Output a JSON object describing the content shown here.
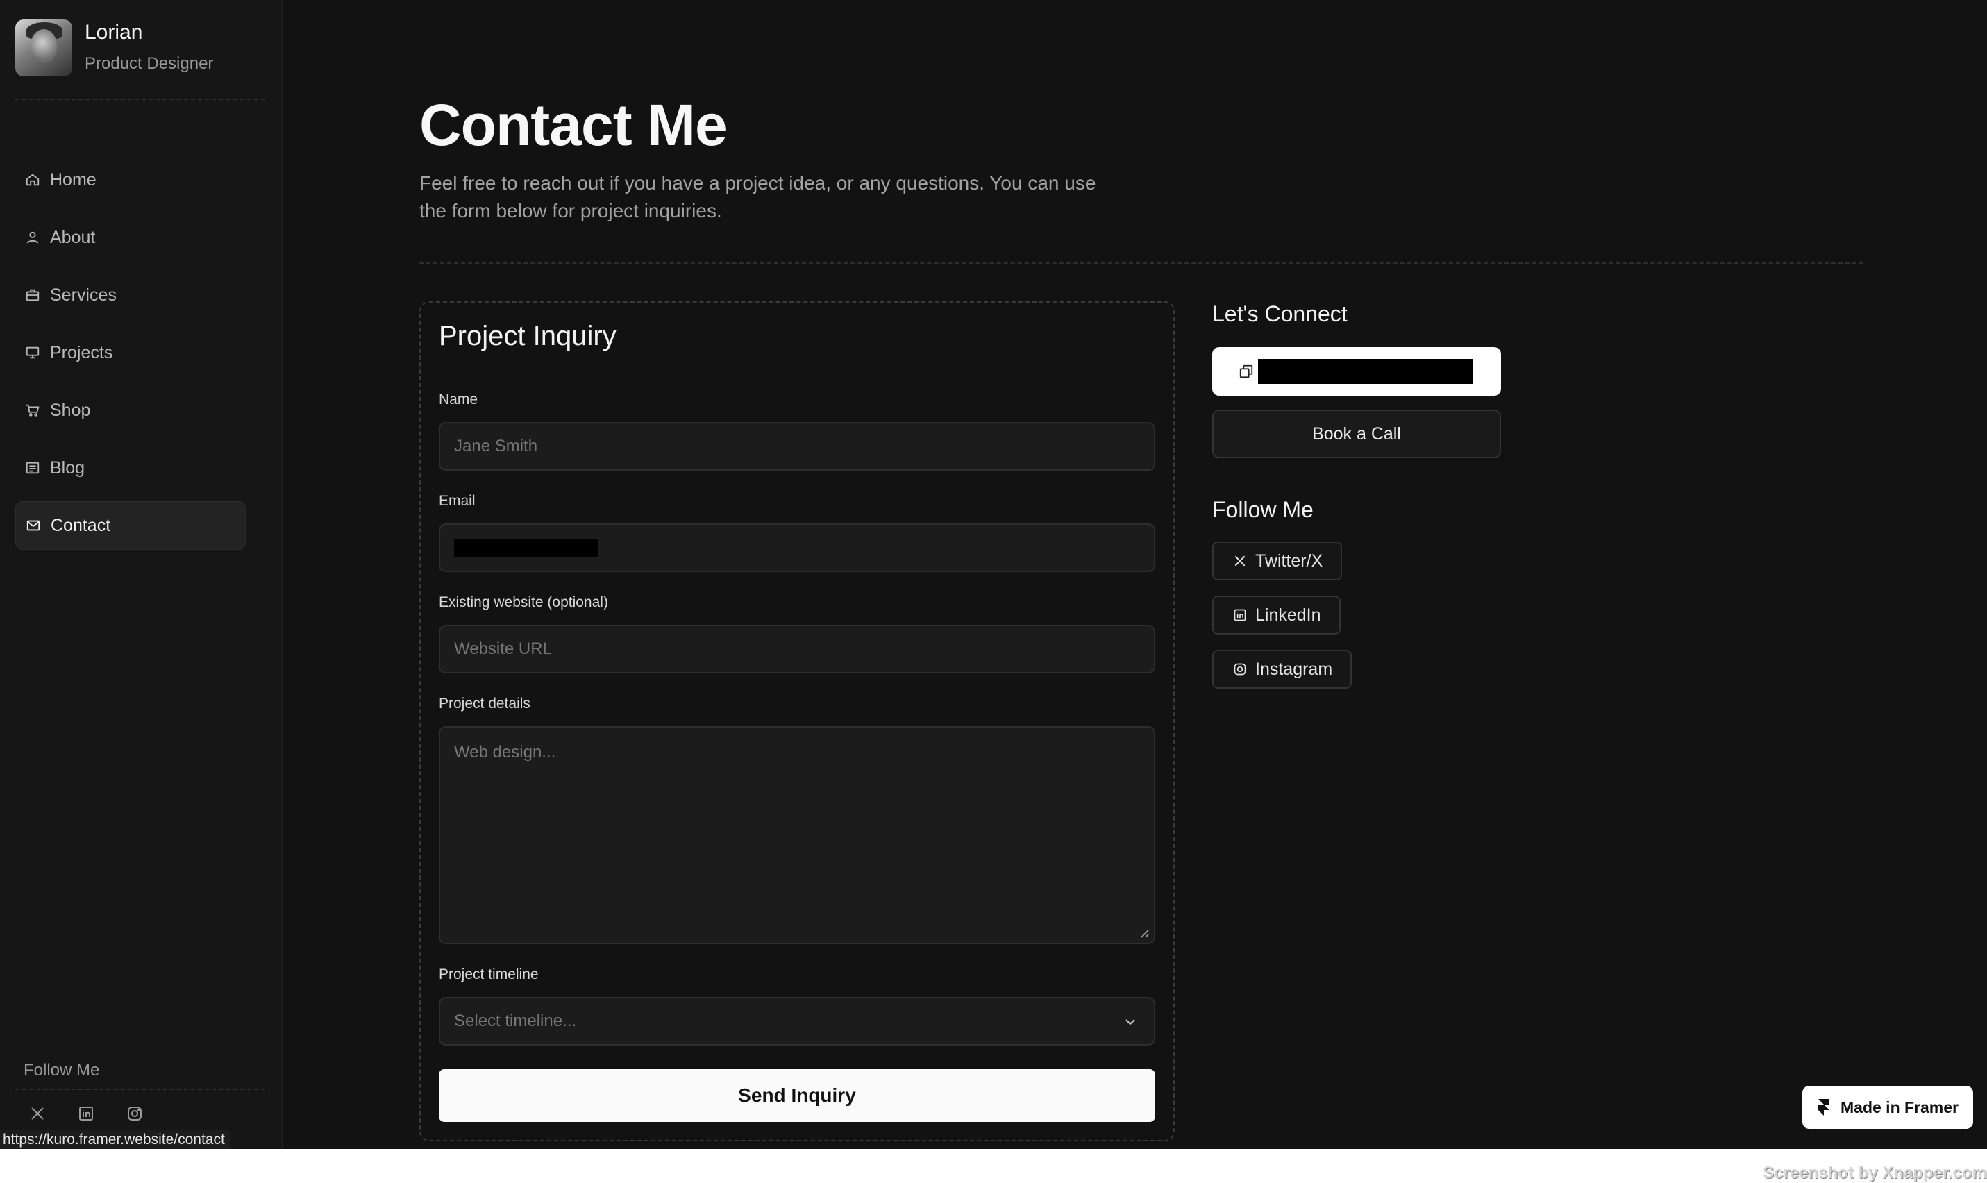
{
  "profile": {
    "name": "Lorian",
    "role": "Product Designer"
  },
  "nav": {
    "items": [
      {
        "label": "Home",
        "icon": "home-icon"
      },
      {
        "label": "About",
        "icon": "user-icon"
      },
      {
        "label": "Services",
        "icon": "briefcase-icon"
      },
      {
        "label": "Projects",
        "icon": "projects-icon"
      },
      {
        "label": "Shop",
        "icon": "cart-icon"
      },
      {
        "label": "Blog",
        "icon": "blog-icon"
      },
      {
        "label": "Contact",
        "icon": "mail-icon",
        "active": true
      }
    ]
  },
  "sidebar_follow": {
    "label": "Follow Me",
    "icons": [
      "x-icon",
      "linkedin-icon",
      "instagram-icon"
    ]
  },
  "status_bar": {
    "url": "https://kuro.framer.website/contact"
  },
  "page": {
    "title": "Contact Me",
    "subtitle": "Feel free to reach out if you have a project idea, or any questions. You can use the form below for project inquiries."
  },
  "form": {
    "title": "Project Inquiry",
    "name": {
      "label": "Name",
      "placeholder": "Jane Smith"
    },
    "email": {
      "label": "Email",
      "value": ""
    },
    "website": {
      "label": "Existing website (optional)",
      "placeholder": "Website URL"
    },
    "details": {
      "label": "Project details",
      "placeholder": "Web design..."
    },
    "timeline": {
      "label": "Project timeline",
      "placeholder": "Select timeline..."
    },
    "submit_label": "Send Inquiry"
  },
  "connect": {
    "title": "Let's Connect",
    "copy_icon": "copy-icon",
    "book_call_label": "Book a Call"
  },
  "follow": {
    "title": "Follow Me",
    "links": [
      {
        "label": "Twitter/X",
        "icon": "x-icon"
      },
      {
        "label": "LinkedIn",
        "icon": "linkedin-icon"
      },
      {
        "label": "Instagram",
        "icon": "instagram-icon"
      }
    ]
  },
  "framer_badge": {
    "label": "Made in Framer"
  },
  "watermark": {
    "text": "Screenshot by Xnapper.com"
  },
  "colors": {
    "background": "#121212",
    "sidebar": "#161616",
    "accent": "#ffffff"
  }
}
